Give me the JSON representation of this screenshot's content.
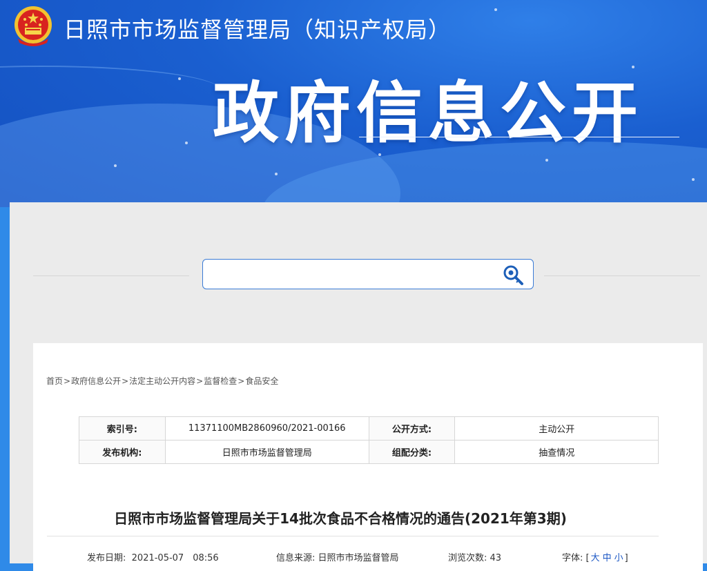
{
  "header": {
    "site_name": "日照市市场监督管理局（知识产权局）",
    "banner_title": "政府信息公开",
    "emblem": "national-emblem-icon"
  },
  "search": {
    "placeholder": "",
    "icon": "search-icon"
  },
  "breadcrumb": {
    "items": [
      "首页",
      "政府信息公开",
      "法定主动公开内容",
      "监督检查",
      "食品安全"
    ],
    "separator": ">"
  },
  "meta": {
    "index_label": "索引号:",
    "index_value": "11371100MB2860960/2021-00166",
    "disclosure_label": "公开方式:",
    "disclosure_value": "主动公开",
    "publisher_label": "发布机构:",
    "publisher_value": "日照市市场监督管理局",
    "category_label": "组配分类:",
    "category_value": "抽查情况"
  },
  "article": {
    "title": "日照市市场监督管理局关于14批次食品不合格情况的通告(2021年第3期)",
    "publish_date_label": "发布日期:",
    "publish_date": "2021-05-07　08:56",
    "source_label": "信息来源:",
    "source": "日照市市场监督管局",
    "views_label": "浏览次数:",
    "views": "43",
    "font_label": "字体:",
    "bracket_open": "[",
    "font_large": "大",
    "font_medium": "中",
    "font_small": "小",
    "bracket_close": "]"
  },
  "colors": {
    "header_blue": "#1a5fd0",
    "accent": "#3a7bd5",
    "link": "#1a56c4"
  }
}
